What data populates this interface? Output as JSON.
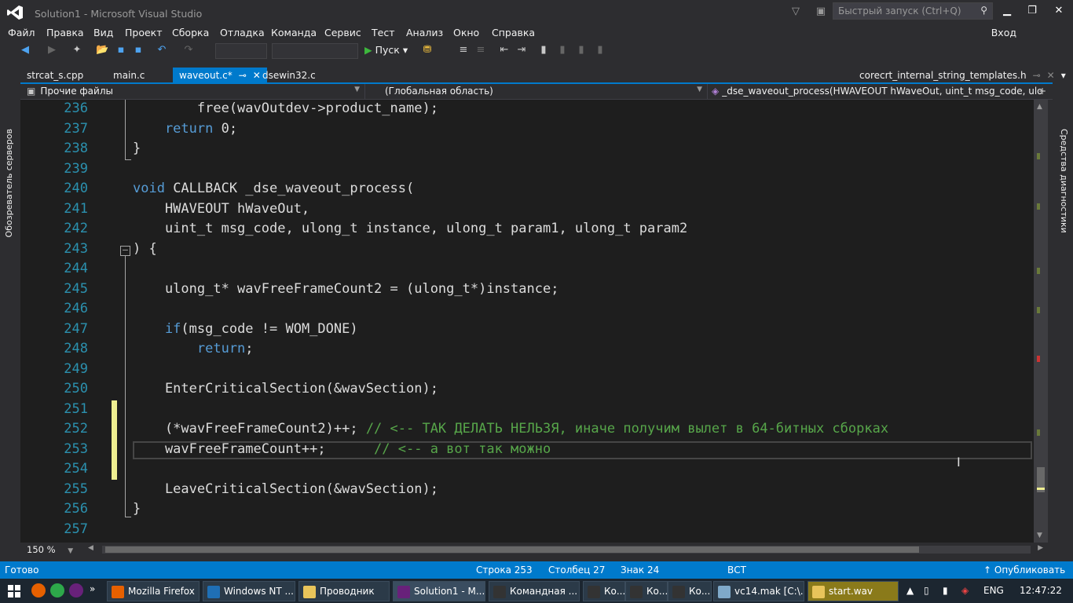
{
  "window": {
    "title": "Solution1 - Microsoft Visual Studio",
    "quick_launch": "Быстрый запуск (Ctrl+Q)"
  },
  "menu": [
    "Файл",
    "Правка",
    "Вид",
    "Проект",
    "Сборка",
    "Отладка",
    "Команда",
    "Сервис",
    "Тест",
    "Анализ",
    "Окно",
    "Справка"
  ],
  "signin": "Вход",
  "toolbar": {
    "run_label": "Пуск"
  },
  "left_rail": "Обозреватель серверов",
  "right_rail": "Средства диагностики",
  "tabs": [
    {
      "label": "strcat_s.cpp"
    },
    {
      "label": "main.c"
    },
    {
      "label": "waveout.c*",
      "active": true
    },
    {
      "label": "dsewin32.c"
    },
    {
      "label": "corecrt_internal_string_templates.h"
    }
  ],
  "nav": {
    "project": "Прочие файлы",
    "scope": "(Глобальная область)",
    "member": "_dse_waveout_process(HWAVEOUT hWaveOut, uint_t msg_code, ulong_t ir"
  },
  "code": [
    {
      "n": "236",
      "t": "        free(wavOutdev->product_name);"
    },
    {
      "n": "237",
      "kw": "    return",
      "t": " 0;"
    },
    {
      "n": "238",
      "t": "}"
    },
    {
      "n": "239",
      "t": ""
    },
    {
      "n": "240",
      "kw": "void",
      "t": " CALLBACK _dse_waveout_process("
    },
    {
      "n": "241",
      "t": "    HWAVEOUT hWaveOut,"
    },
    {
      "n": "242",
      "t": "    uint_t msg_code, ulong_t instance, ulong_t param1, ulong_t param2"
    },
    {
      "n": "243",
      "t": ") {"
    },
    {
      "n": "244",
      "t": ""
    },
    {
      "n": "245",
      "t": "    ulong_t* wavFreeFrameCount2 = (ulong_t*)instance;"
    },
    {
      "n": "246",
      "t": ""
    },
    {
      "n": "247",
      "kw": "    if",
      "t": "(msg_code != WOM_DONE)"
    },
    {
      "n": "248",
      "kw": "        return",
      "t": ";"
    },
    {
      "n": "249",
      "t": ""
    },
    {
      "n": "250",
      "t": "    EnterCriticalSection(&wavSection);"
    },
    {
      "n": "251",
      "t": ""
    },
    {
      "n": "252",
      "t": "    (*wavFreeFrameCount2)++; ",
      "c": "// <-- ТАК ДЕЛАТЬ НЕЛЬЗЯ, иначе получим вылет в 64-битных сборках"
    },
    {
      "n": "253",
      "t": "    wavFreeFrameCount++;      ",
      "c": "// <-- а вот так можно"
    },
    {
      "n": "254",
      "t": ""
    },
    {
      "n": "255",
      "t": "    LeaveCriticalSection(&wavSection);"
    },
    {
      "n": "256",
      "t": "}"
    },
    {
      "n": "257",
      "t": ""
    }
  ],
  "zoom": "150 %",
  "status": {
    "ready": "Готово",
    "row": "Строка 253",
    "col": "Столбец 27",
    "char": "Знак 24",
    "mode": "ВСТ",
    "publish": "Опубликовать"
  },
  "taskbar": {
    "apps": [
      "Mozilla Firefox",
      "Windows NT ...",
      "Проводник",
      "Solution1 - M...",
      "Командная ...",
      "Ко...",
      "Ко...",
      "Ко...",
      "vc14.mak [C:\\...",
      "start.wav"
    ],
    "lang": "ENG",
    "time": "12:47:22"
  }
}
